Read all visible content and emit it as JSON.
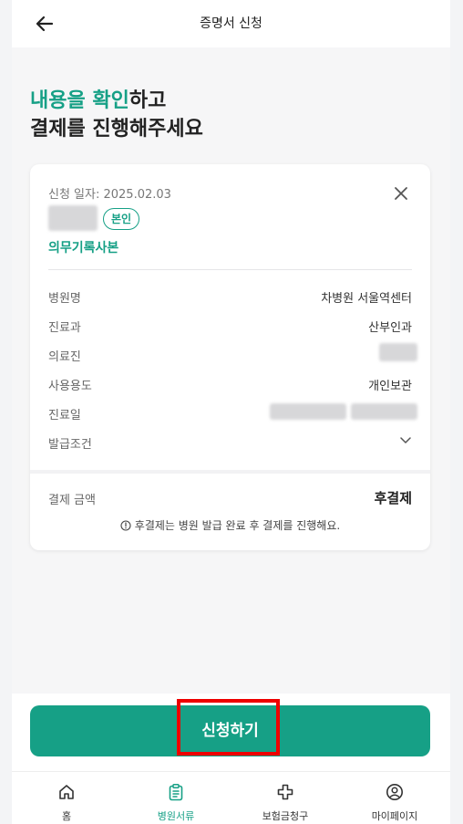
{
  "header": {
    "title": "증명서 신청"
  },
  "headline": {
    "accent": "내용을 확인",
    "rest1": "하고",
    "line2": "결제를 진행해주세요"
  },
  "card": {
    "date": "신청 일자: 2025.02.03",
    "badge": "본인",
    "doc_type": "의무기록사본",
    "rows": [
      {
        "label": "병원명",
        "value": "차병원 서울역센터"
      },
      {
        "label": "진료과",
        "value": "산부인과"
      },
      {
        "label": "의료진",
        "value": ""
      },
      {
        "label": "사용용도",
        "value": "개인보관"
      },
      {
        "label": "진료일",
        "value": ""
      },
      {
        "label": "발급조건",
        "value": ""
      }
    ],
    "payment": {
      "label": "결제 금액",
      "value": "후결제"
    },
    "notice": "후결제는 병원 발급 완료 후 결제를 진행해요."
  },
  "apply_button": "신청하기",
  "nav": [
    {
      "label": "홈",
      "icon": "home-icon"
    },
    {
      "label": "병원서류",
      "icon": "clipboard-icon"
    },
    {
      "label": "보험금청구",
      "icon": "plus-cross-icon"
    },
    {
      "label": "마이페이지",
      "icon": "user-circle-icon"
    }
  ],
  "colors": {
    "accent": "#16a086",
    "highlight": "#e00000"
  }
}
